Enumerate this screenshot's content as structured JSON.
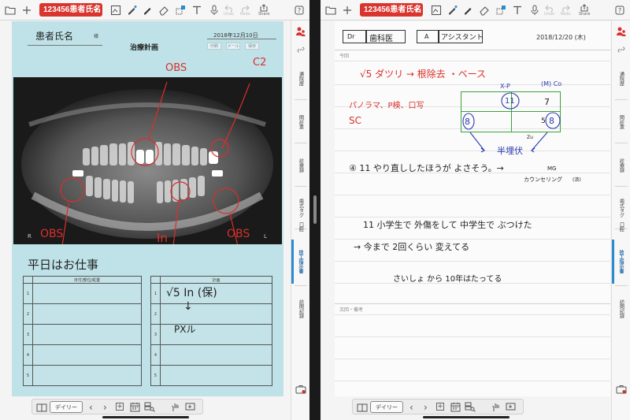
{
  "toolbar": {
    "patient_badge": "123456患者氏名",
    "undo_label": "Undo",
    "redo_label": "Redo",
    "share_label": "Share"
  },
  "sidebar": {
    "tabs": [
      "通院歴",
      "問診票",
      "診療録",
      "歯式タグ",
      "口腔",
      "技工指示書",
      "訪問記録"
    ],
    "active_tab": "技工指示書"
  },
  "bottombar": {
    "daily_label": "デイリー",
    "prev": "‹",
    "next": "›",
    "add": "+"
  },
  "left_doc": {
    "patient_label_hw": "患者氏名",
    "patient_honorific": "様",
    "title": "治療計画",
    "date": "2018年12月10日",
    "chips": [
      "印刷",
      "メール",
      "保存"
    ],
    "xray_left_mark": "R",
    "xray_right_mark": "L",
    "annotations": {
      "obs_top": "OBS",
      "c2": "C2",
      "obs_left": "OBS",
      "in": "In",
      "obs_right": "OBS"
    },
    "note": "平日はお仕事",
    "table_left_header": "日付/部位/処置",
    "table_right_header": "計画",
    "row_numbers": [
      "1",
      "2",
      "3",
      "4",
      "5"
    ],
    "plan_row1": "√5 In (保)",
    "plan_arrow": "↓",
    "plan_row2": "PXル"
  },
  "right_doc": {
    "dr_label": "Dr",
    "dr_name": "歯科医",
    "a_label": "A",
    "a_name": "アシスタント",
    "date": "2018/12/20 (木)",
    "section_today": "今回",
    "section_next": "次回・備考",
    "line1": "√5 ダツリ → 根除去 ・ベース",
    "line2a": "パノラマ、P検、口写",
    "line2b": "SC",
    "xp_label": "X-P",
    "mc_label": "(M) Co",
    "grid_tl": "11",
    "grid_tr": "7",
    "grid_bl": "8",
    "grid_br_small": "5",
    "grid_br": "8",
    "grid_sub": "Zu",
    "grid_caption": "半埋伏",
    "note1": "④ 11 やり直ししたほうが よさそう。→",
    "mg_label": "MG",
    "counseling": "カウンセリング",
    "counseling_mark": "(済)",
    "note2": "11 小学生で 外傷をして 中学生で ぶつけた",
    "note3": "→ 今まで 2回くらい 変えてる",
    "note4": "さいしょ から 10年はたってる"
  }
}
